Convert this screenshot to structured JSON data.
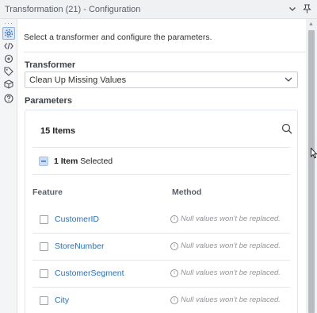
{
  "window": {
    "title": "Transformation (21) - Configuration"
  },
  "intro_text": "Select a transformer and configure the parameters.",
  "transformer": {
    "label": "Transformer",
    "selected": "Clean Up Missing Values"
  },
  "parameters": {
    "label": "Parameters",
    "items_count": "15 Items",
    "selected_count": "1 Item",
    "selected_suffix": "Selected",
    "column_feature": "Feature",
    "column_method": "Method",
    "rows": [
      {
        "feature": "CustomerID",
        "method": "Null values won't be replaced."
      },
      {
        "feature": "StoreNumber",
        "method": "Null values won't be replaced."
      },
      {
        "feature": "CustomerSegment",
        "method": "Null values won't be replaced."
      },
      {
        "feature": "City",
        "method": "Null values won't be replaced."
      }
    ]
  },
  "left_toolbar_icons": [
    "gear-icon",
    "code-icon",
    "sync-icon",
    "tag-icon",
    "cube-icon",
    "help-icon"
  ],
  "colors": {
    "accent": "#2a6fb3",
    "titlebar_bg": "#f0f1f3"
  }
}
